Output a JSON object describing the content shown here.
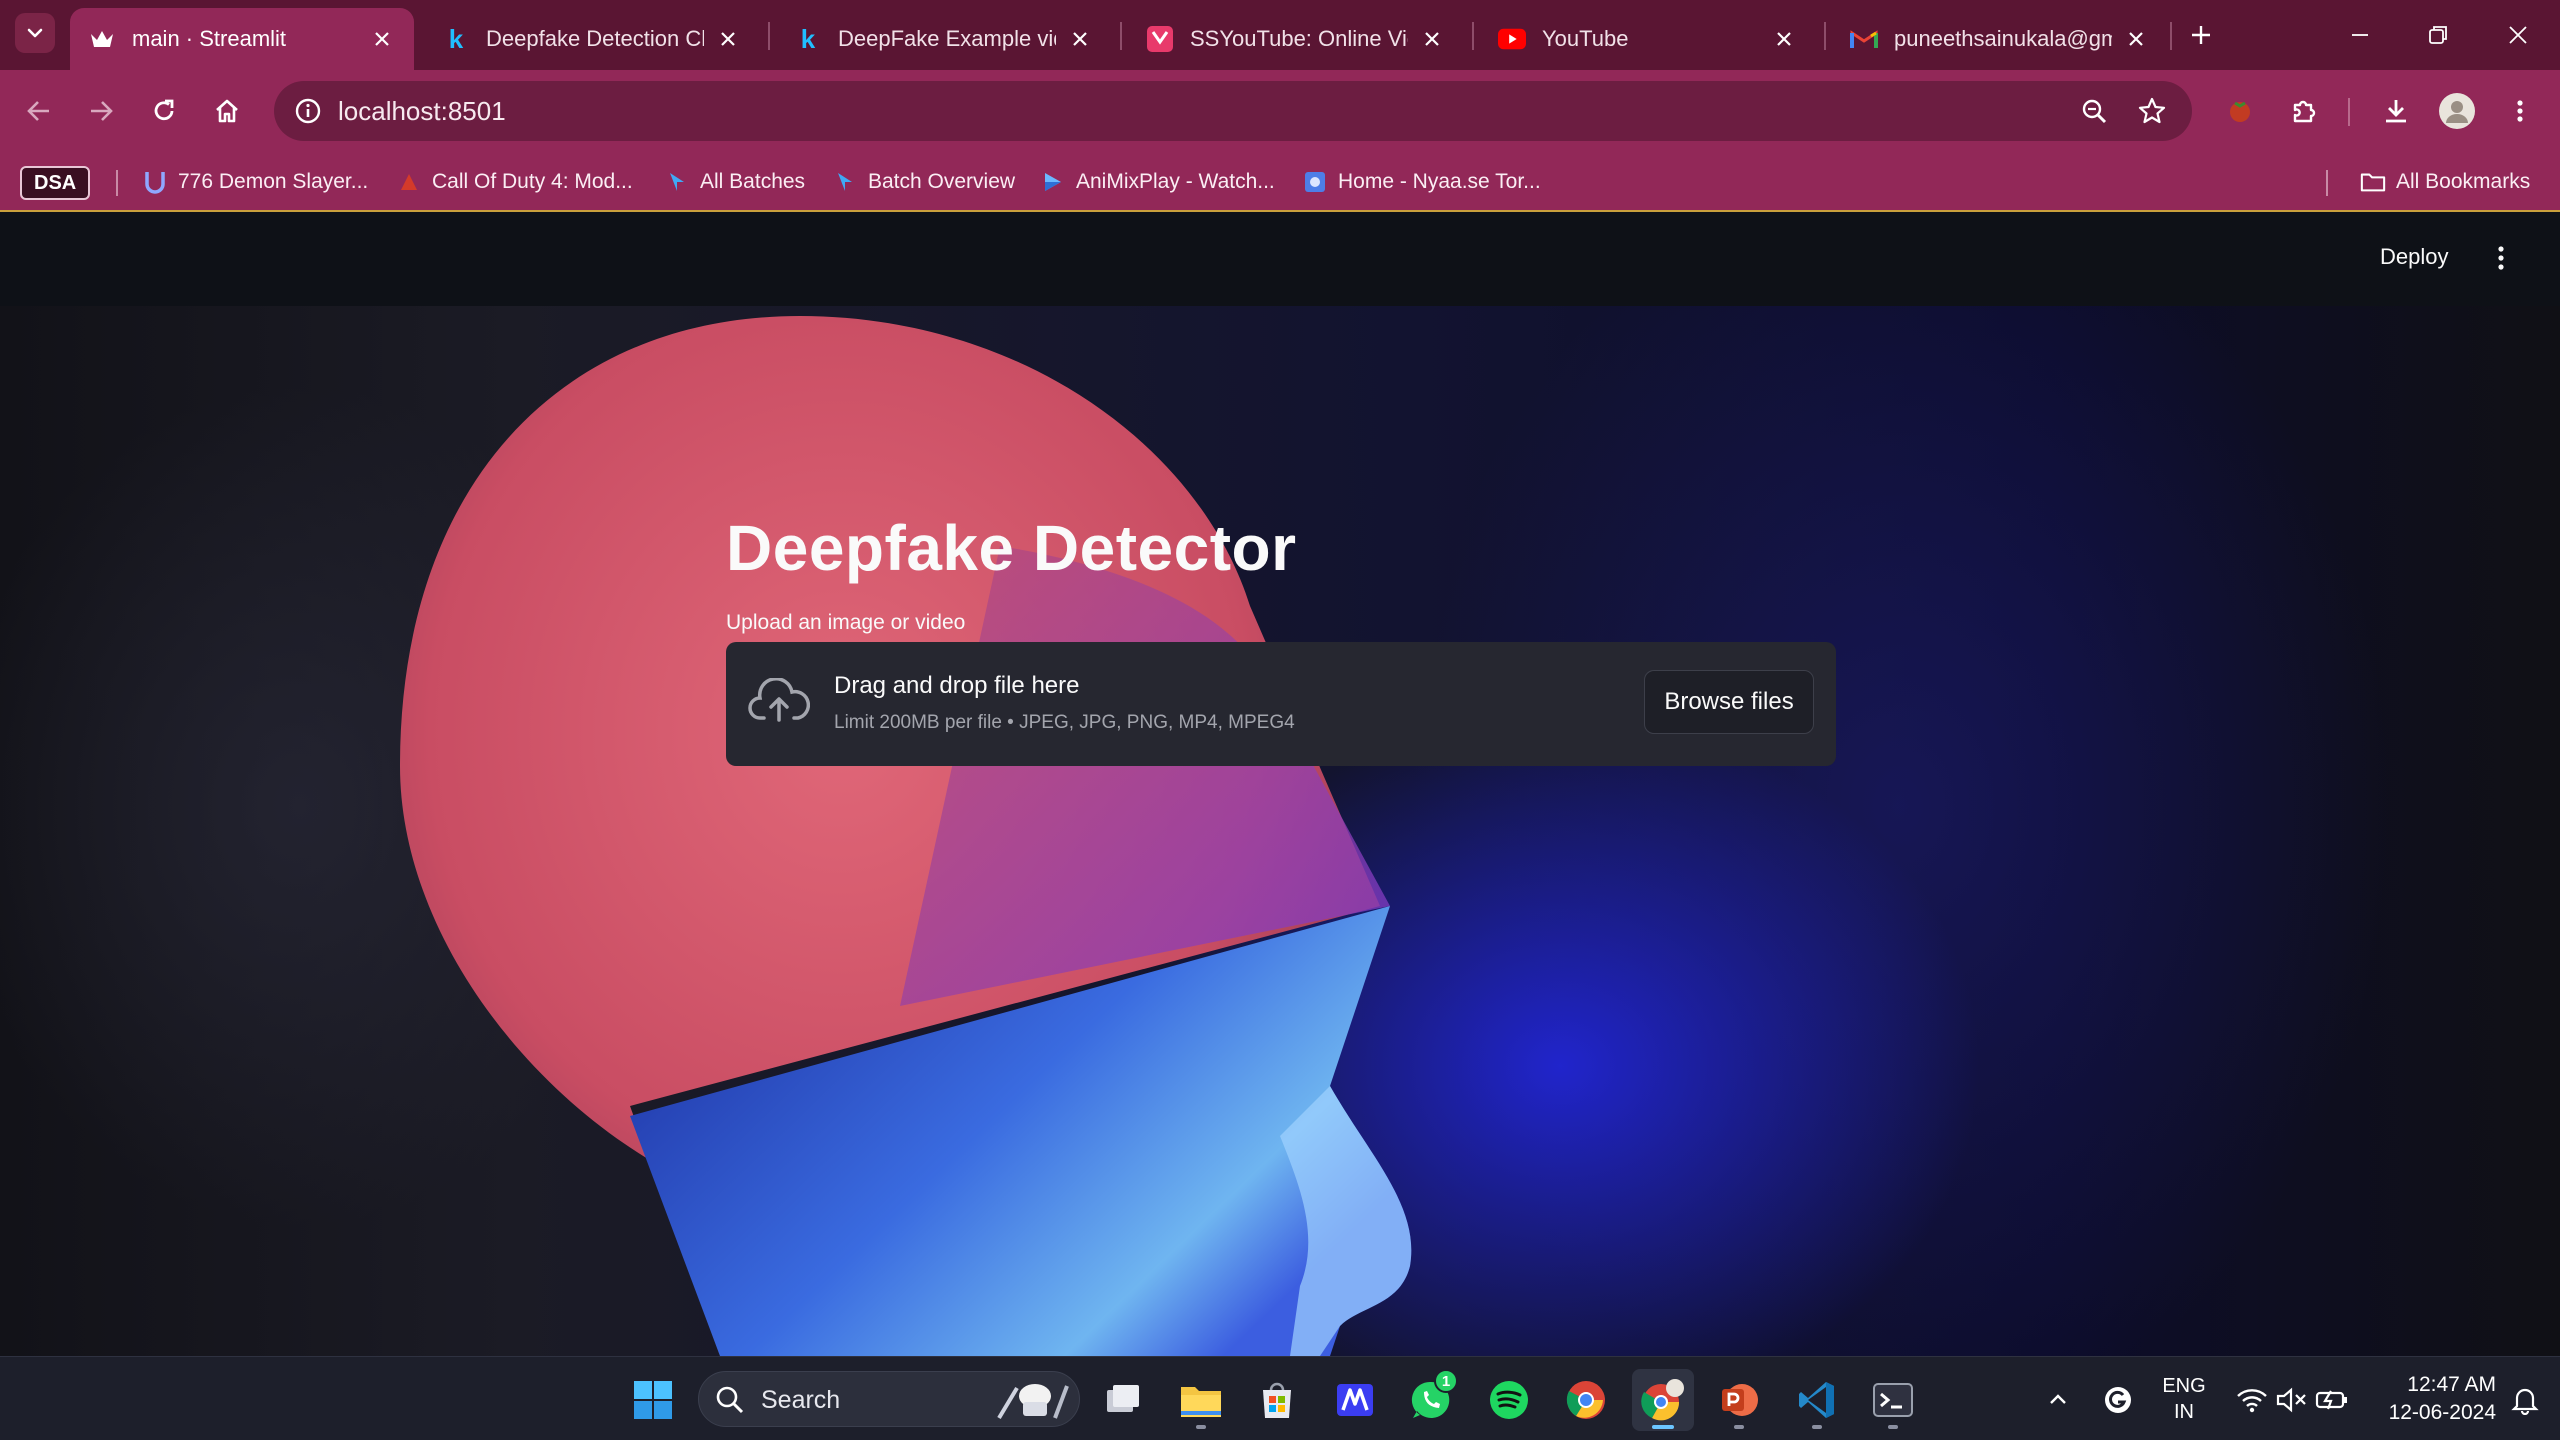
{
  "browser": {
    "tabs": [
      {
        "title": "main · Streamlit",
        "icon": "streamlit-crown-icon",
        "active": true
      },
      {
        "title": "Deepfake Detection Cha",
        "icon": "kaggle-k-icon",
        "active": false
      },
      {
        "title": "DeepFake Example videc",
        "icon": "kaggle-k-icon",
        "active": false
      },
      {
        "title": "SSYouTube: Online Videc",
        "icon": "ssyoutube-icon",
        "active": false
      },
      {
        "title": "YouTube",
        "icon": "youtube-icon",
        "active": false
      },
      {
        "title": "puneethsainukala@gma",
        "icon": "gmail-icon",
        "active": false
      }
    ],
    "url": "localhost:8501",
    "bookmarks": [
      {
        "label": "776 Demon Slayer...",
        "icon": "bookmark-u-icon"
      },
      {
        "label": "Call Of Duty 4: Mod...",
        "icon": "bookmark-cod-icon"
      },
      {
        "label": "All Batches",
        "icon": "bookmark-pw-icon"
      },
      {
        "label": "Batch Overview",
        "icon": "bookmark-pw-icon"
      },
      {
        "label": "AniMixPlay - Watch...",
        "icon": "bookmark-animix-icon"
      },
      {
        "label": "Home - Nyaa.se Tor...",
        "icon": "bookmark-nyaa-icon"
      }
    ],
    "bookmark_folder_dsa": "DSA",
    "all_bookmarks": "All Bookmarks"
  },
  "app": {
    "deploy_label": "Deploy",
    "title": "Deepfake Detector",
    "uploader": {
      "label": "Upload an image or video",
      "drop_text": "Drag and drop file here",
      "limit_text": "Limit 200MB per file • JPEG, JPG, PNG, MP4, MPEG4",
      "browse_label": "Browse files"
    }
  },
  "taskbar": {
    "search_label": "Search",
    "whatsapp_badge": "1",
    "lang_line1": "ENG",
    "lang_line2": "IN",
    "time": "12:47 AM",
    "date": "12-06-2024"
  },
  "colors": {
    "tabstrip": "#5a1533",
    "toolbar": "#922858",
    "page_bg": "#0e1117",
    "uploader_bg": "#262730"
  }
}
